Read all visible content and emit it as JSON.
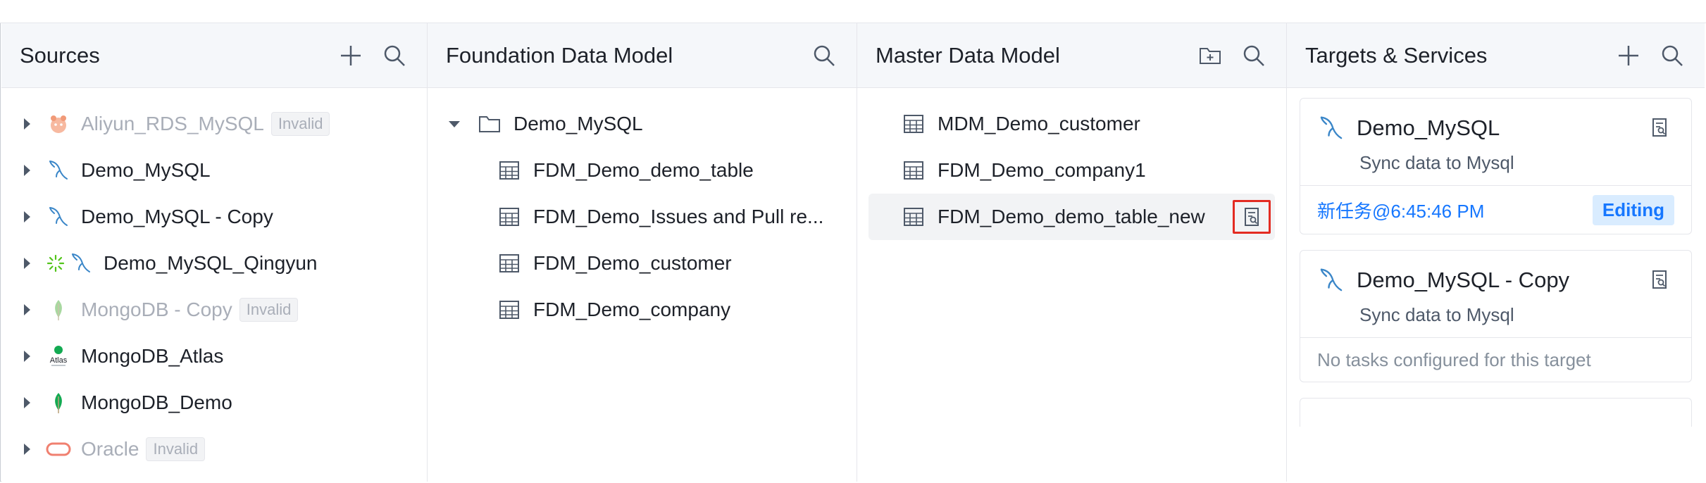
{
  "sources": {
    "title": "Sources",
    "items": [
      {
        "label": "Aliyun_RDS_MySQL",
        "badge": "Invalid",
        "icon": "aliyun-icon",
        "invalid": true
      },
      {
        "label": "Demo_MySQL",
        "icon": "mysql-dolphin-icon"
      },
      {
        "label": "Demo_MySQL - Copy",
        "icon": "mysql-dolphin-icon"
      },
      {
        "label": "Demo_MySQL_Qingyun",
        "icon": "loading-spinner-icon"
      },
      {
        "label": "MongoDB - Copy",
        "badge": "Invalid",
        "icon": "mongodb-leaf-icon",
        "invalid": true
      },
      {
        "label": "MongoDB_Atlas",
        "icon": "mongodb-atlas-icon",
        "icon_text": "Atlas"
      },
      {
        "label": "MongoDB_Demo",
        "icon": "mongodb-leaf-icon"
      },
      {
        "label": "Oracle",
        "badge": "Invalid",
        "icon": "oracle-icon",
        "invalid": true
      }
    ]
  },
  "fdm": {
    "title": "Foundation Data Model",
    "folder": "Demo_MySQL",
    "tables": [
      "FDM_Demo_demo_table",
      "FDM_Demo_Issues and Pull re...",
      "FDM_Demo_customer",
      "FDM_Demo_company"
    ]
  },
  "mdm": {
    "title": "Master Data Model",
    "tables": [
      "MDM_Demo_customer",
      "FDM_Demo_company1",
      "FDM_Demo_demo_table_new"
    ]
  },
  "targets": {
    "title": "Targets & Services",
    "cards": [
      {
        "name": "Demo_MySQL",
        "desc": "Sync data to Mysql",
        "task": "新任务@6:45:46 PM",
        "status": "Editing"
      },
      {
        "name": "Demo_MySQL - Copy",
        "desc": "Sync data to Mysql",
        "empty": "No tasks configured for this target"
      }
    ]
  },
  "colors": {
    "accent": "#1677ff",
    "highlight": "#e32b22",
    "invalid": "#a9aeb8"
  }
}
